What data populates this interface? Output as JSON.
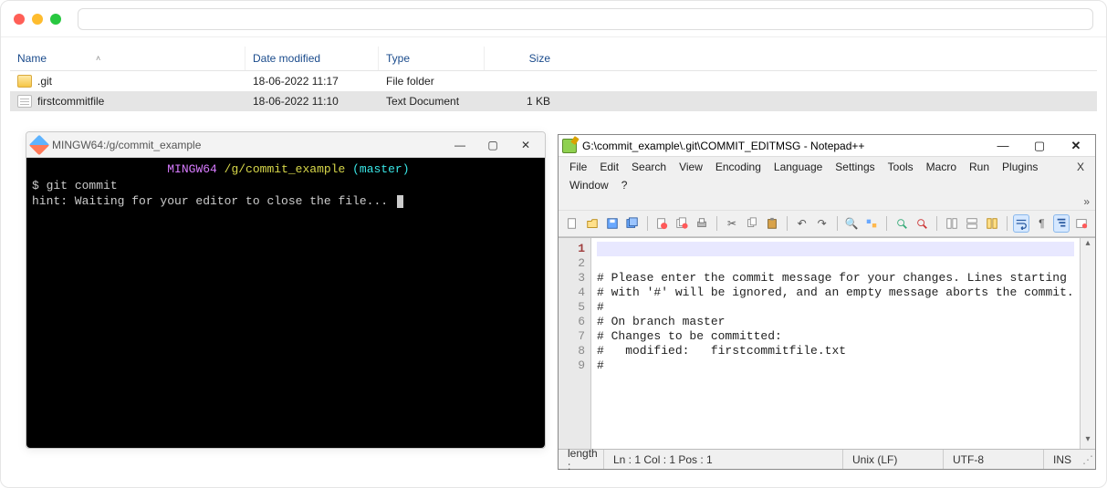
{
  "explorer": {
    "columns": {
      "name": "Name",
      "date": "Date modified",
      "type": "Type",
      "size": "Size"
    },
    "rows": [
      {
        "name": ".git",
        "date": "18-06-2022 11:17",
        "type": "File folder",
        "size": "",
        "kind": "folder",
        "selected": false
      },
      {
        "name": "firstcommitfile",
        "date": "18-06-2022 11:10",
        "type": "Text Document",
        "size": "1 KB",
        "kind": "file",
        "selected": true
      }
    ]
  },
  "terminal": {
    "title": "MINGW64:/g/commit_example",
    "prompt_host": "MINGW64",
    "prompt_path": "/g/commit_example",
    "prompt_branch": "(master)",
    "command": "git commit",
    "hint": "hint: Waiting for your editor to close the file..."
  },
  "npp": {
    "title": "G:\\commit_example\\.git\\COMMIT_EDITMSG - Notepad++",
    "menu": [
      "File",
      "Edit",
      "Search",
      "View",
      "Encoding",
      "Language",
      "Settings",
      "Tools",
      "Macro",
      "Run",
      "Plugins",
      "Window",
      "?"
    ],
    "dbl_arrow": "»",
    "lines": [
      "",
      "# Please enter the commit message for your changes. Lines starting",
      "# with '#' will be ignored, and an empty message aborts the commit.",
      "#",
      "# On branch master",
      "# Changes to be committed:",
      "#   modified:   firstcommitfile.txt",
      "#",
      ""
    ],
    "status": {
      "length_label": "length :",
      "pos": "Ln : 1   Col : 1   Pos : 1",
      "eol": "Unix (LF)",
      "enc": "UTF-8",
      "ins": "INS"
    },
    "winbtns": {
      "min": "—",
      "max": "▢",
      "close": "✕"
    }
  },
  "termbtns": {
    "min": "—",
    "max": "▢",
    "close": "✕"
  }
}
